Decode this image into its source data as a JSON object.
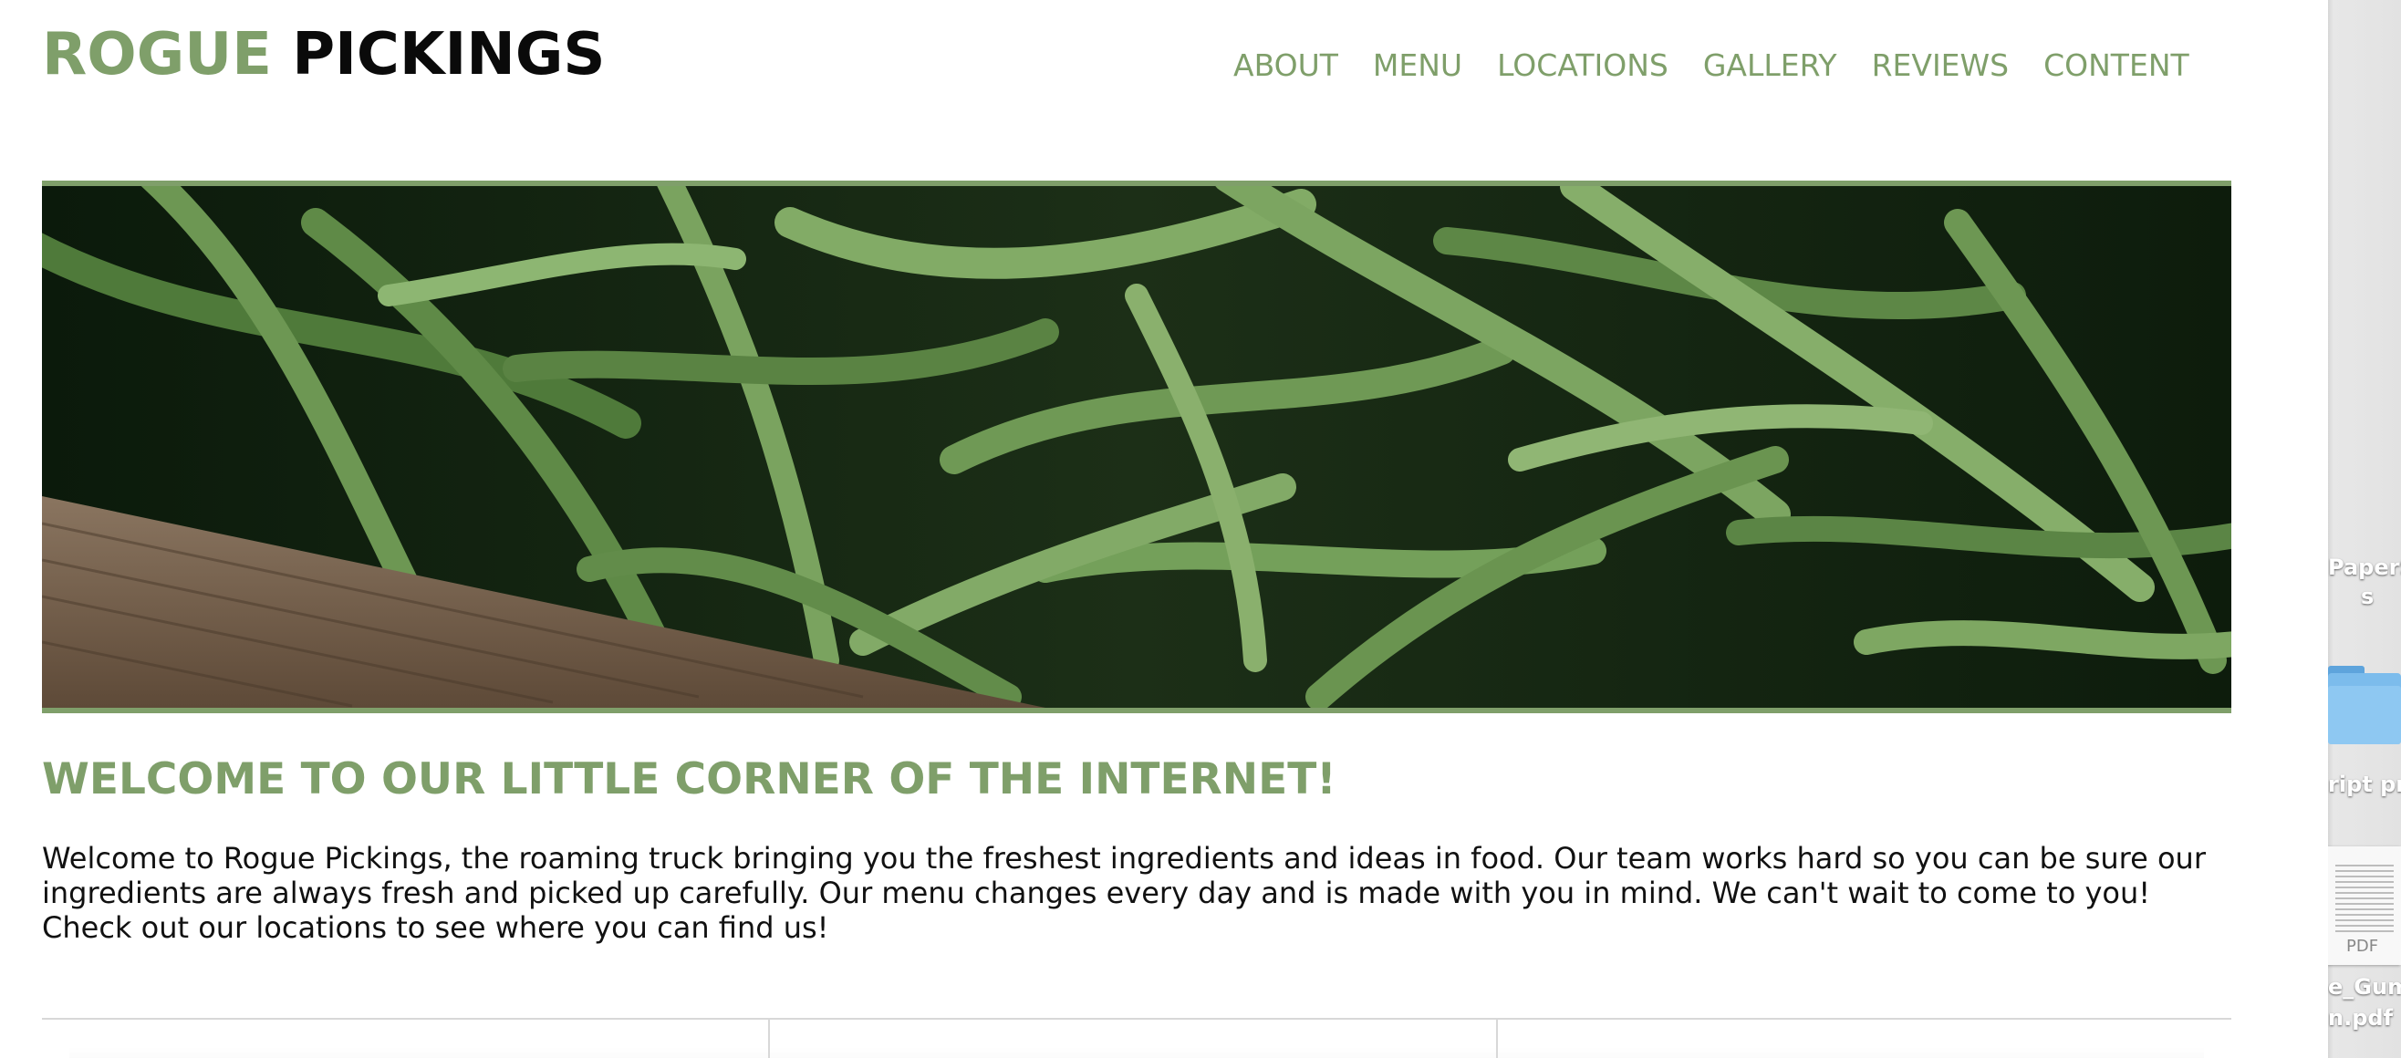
{
  "site": {
    "logo_first": "ROGUE",
    "logo_second": "PICKINGS"
  },
  "nav": {
    "items": [
      {
        "label": "ABOUT"
      },
      {
        "label": "MENU"
      },
      {
        "label": "LOCATIONS"
      },
      {
        "label": "GALLERY"
      },
      {
        "label": "REVIEWS"
      },
      {
        "label": "CONTENT"
      }
    ]
  },
  "main": {
    "heading": "WELCOME TO OUR LITTLE CORNER OF THE INTERNET!",
    "paragraph": "Welcome to Rogue Pickings, the roaming truck bringing you the freshest ingredients and ideas in food. Our team works hard so you can be sure our ingredients are always fresh and picked up carefully. Our menu changes every day and is made with you in mind. We can't wait to come to you! Check out our locations to see where you can find us!"
  },
  "desktop": {
    "item1_label_line1": "PaperS",
    "item1_label_line2": "s",
    "item2_label": "ript pra",
    "item3_label_line1": "e_Gum",
    "item3_label_line2": "n.pdf",
    "pdf_tag": "PDF"
  },
  "colors": {
    "accent": "#7f9f6a",
    "logo_dark": "#0a0a0a",
    "body_text": "#111111"
  }
}
